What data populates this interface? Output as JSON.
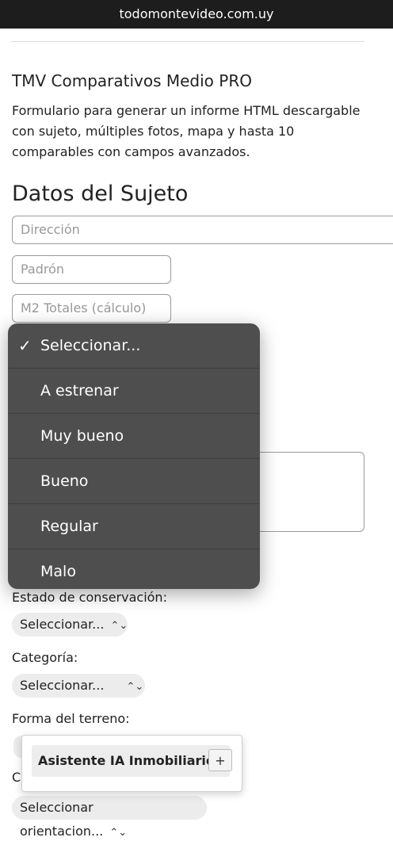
{
  "browser": {
    "url": "todomontevideo.com.uy"
  },
  "page": {
    "title": "TMV Comparativos Medio PRO",
    "description": "Formulario para generar un informe HTML descargable con sujeto, múltiples fotos, mapa y hasta 10 comparables con campos avanzados.",
    "section_title": "Datos del Sujeto"
  },
  "form": {
    "direccion_placeholder": "Dirección",
    "padron_placeholder": "Padrón",
    "m2_placeholder": "M2 Totales (cálculo)",
    "estado_label": "Estado de conservación:",
    "estado_value": "Seleccionar...",
    "categoria_label": "Categoría:",
    "categoria_value": "Seleccionar...",
    "forma_label": "Forma del terreno:",
    "partial_label": "C",
    "orientacion_value": "Seleccionar orientacion..."
  },
  "dropdown": {
    "options": [
      "Seleccionar...",
      "A estrenar",
      "Muy bueno",
      "Bueno",
      "Regular",
      "Malo"
    ],
    "selected_index": 0,
    "check_glyph": "✓"
  },
  "assistant": {
    "label": "Asistente IA Inmobiliario",
    "plus": "+"
  },
  "icons": {
    "select_chevron": "chevron-updown-icon",
    "check": "checkmark-icon"
  },
  "colors": {
    "topbar": "#1d1d1d",
    "dropdown_bg": "#4e4e4e",
    "select_bg": "#ececec"
  }
}
